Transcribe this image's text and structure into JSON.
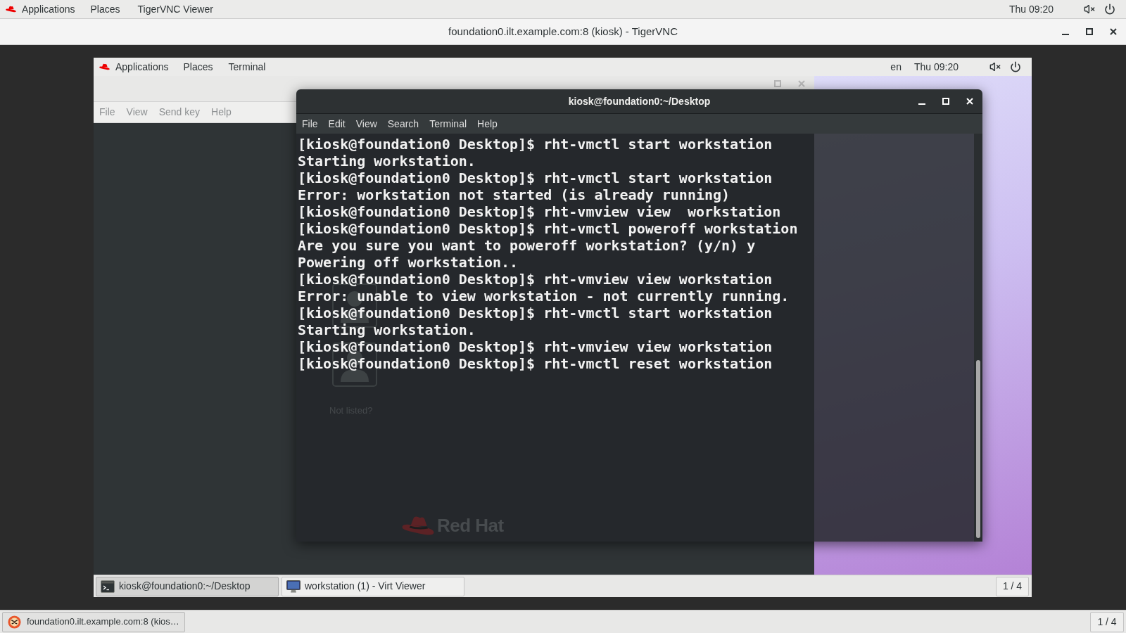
{
  "top_bar": {
    "menus": [
      "Applications",
      "Places",
      "TigerVNC Viewer"
    ],
    "clock": "Thu 09:20"
  },
  "vnc_window": {
    "title": "foundation0.ilt.example.com:8 (kiosk) - TigerVNC"
  },
  "remote_desktop": {
    "top_bar": {
      "menus": [
        "Applications",
        "Places",
        "Terminal"
      ],
      "keyboard_layout": "en",
      "clock": "Thu 09:20"
    },
    "virt_viewer": {
      "menus": [
        "File",
        "View",
        "Send key",
        "Help"
      ],
      "login_screen": {
        "link": "Not listed?",
        "logo_text": "Red Hat"
      }
    },
    "terminal": {
      "title": "kiosk@foundation0:~/Desktop",
      "menus": [
        "File",
        "Edit",
        "View",
        "Search",
        "Terminal",
        "Help"
      ],
      "lines": [
        "[kiosk@foundation0 Desktop]$ rht-vmctl start workstation",
        "Starting workstation.",
        "[kiosk@foundation0 Desktop]$ rht-vmctl start workstation",
        "Error: workstation not started (is already running)",
        "[kiosk@foundation0 Desktop]$ rht-vmview view  workstation",
        "[kiosk@foundation0 Desktop]$ rht-vmctl poweroff workstation",
        "Are you sure you want to poweroff workstation? (y/n) y",
        "Powering off workstation..",
        "[kiosk@foundation0 Desktop]$ rht-vmview view workstation",
        "Error: unable to view workstation - not currently running.",
        "[kiosk@foundation0 Desktop]$ rht-vmctl start workstation",
        "Starting workstation.",
        "[kiosk@foundation0 Desktop]$ rht-vmview view workstation",
        "[kiosk@foundation0 Desktop]$ rht-vmctl reset workstation"
      ]
    },
    "taskbar": {
      "items": [
        {
          "label": "kiosk@foundation0:~/Desktop",
          "kind": "terminal",
          "selected": true
        },
        {
          "label": "workstation (1) - Virt Viewer",
          "kind": "viewer",
          "selected": false
        }
      ],
      "workspace": "1 / 4"
    }
  },
  "taskbar": {
    "items": [
      {
        "label": "foundation0.ilt.example.com:8 (kios…"
      }
    ],
    "workspace": "1 / 4"
  }
}
